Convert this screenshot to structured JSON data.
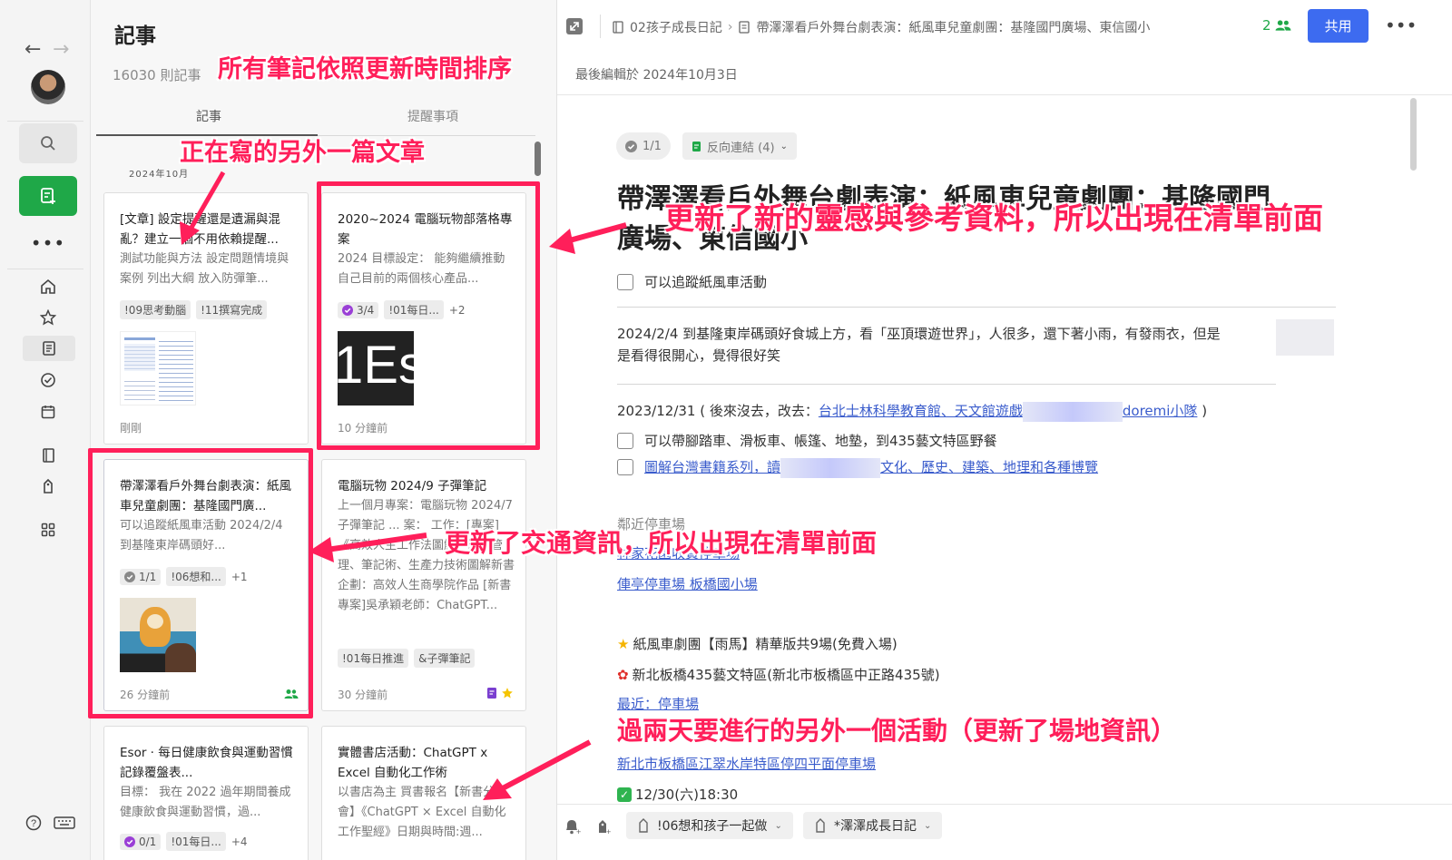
{
  "rail": {
    "back_icon": "arrow-left-icon",
    "forward_icon": "arrow-right-icon",
    "new_note_color": "#1fa848"
  },
  "list": {
    "title": "記事",
    "count": "16030 則記事",
    "tabs": [
      "記事",
      "提醒事項"
    ],
    "month": "2024年10月",
    "cards": [
      {
        "title": "[文章] 設定提醒還是遺漏與混亂？建立一個不用依賴提醒...",
        "snippet": "測試功能與方法 設定問題情境與案例 列出大綱 放入防彈筆...",
        "tags": [
          "!09思考動腦",
          "!11撰寫完成"
        ],
        "time": "剛剛"
      },
      {
        "title": "2020~2024 電腦玩物部落格專案",
        "snippet": "2024 目標設定： 能夠繼續推動自己目前的兩個核心產品...",
        "task": "3/4",
        "tags": [
          "!01每日..."
        ],
        "more": "+2",
        "thumb_text": "1Es",
        "time": "10 分鐘前"
      },
      {
        "title": "帶澤澤看戶外舞台劇表演：紙風車兒童劇團：基隆國門廣...",
        "snippet": "可以追蹤紙風車活動 2024/2/4 到基隆東岸碼頭好...",
        "task": "1/1",
        "tags": [
          "!06想和..."
        ],
        "more": "+1",
        "time": "26 分鐘前"
      },
      {
        "title": "電腦玩物 2024/9 子彈筆記",
        "snippet": "上一個月專案：電腦玩物 2024/7 子彈筆記 ... 案： 工作：[專案]《高效人生工作法圖解》時間管理、筆記術、生產力技術圖解新書企劃：高效人生商學院作品 [新書專案]吳承穎老師：ChatGPT...",
        "tags": [
          "!01每日推進",
          "&子彈筆記"
        ],
        "time": "30 分鐘前"
      },
      {
        "title": "Esor ‧ 每日健康飲食與運動習慣記錄覆盤表...",
        "snippet": "目標： 我在 2022 過年期間養成健康飲食與運動習慣，過...",
        "task": "0/1",
        "tags": [
          "!01每日..."
        ],
        "more": "+4"
      },
      {
        "title": "實體書店活動：ChatGPT x Excel 自動化工作術",
        "snippet": "以書店為主 買書報名【新書分享會】《ChatGPT × Excel 自動化工作聖經》日期與時間:週..."
      }
    ]
  },
  "editor": {
    "breadcrumb_notebook": "02孩子成長日記",
    "breadcrumb_note": "帶澤澤看戶外舞台劇表演：紙風車兒童劇團：基隆國門廣場、東信國小",
    "share_count": "2",
    "share_label": "共用",
    "last_edited": "最後編輯於 2024年10月3日",
    "task_chip": "1/1",
    "backlinks_chip": "反向連結 (4)",
    "title_line1": "帶澤澤看戶外舞台劇表演：紙風車兒童劇團：基隆國門",
    "title_line2": "廣場、東信國小",
    "check1": "可以追蹤紙風車活動",
    "para1_line1": "2024/2/4 到基隆東岸碼頭好食城上方，看「巫頂環遊世界」，人很多，還下著小雨，有發雨衣，但是",
    "para1_line2": "是看得很開心，覺得很好笑",
    "para2_prefix": "2023/12/31 ( 後來沒去，改去：",
    "para2_link": "台北士林科學教育館、天文館遊戲",
    "para2_link_tail": "doremi小隊",
    "para2_suffix": " )",
    "check2": "可以帶腳踏車、滑板車、帳篷、地墊，到435藝文特區野餐",
    "check3_link": "圖解台灣書籍系列，讀",
    "check3_link_tail": "文化、歷史、建築、地理和各種博覽",
    "parking_heading": "鄰近停車場",
    "parking_link1": "林家花園收費停車場",
    "parking_link2": "俥亭停車場 板橋國小場",
    "event_line": "紙風車劇團【雨馬】精華版共9場(免費入場)",
    "venue_line": "新北板橋435藝文特區(新北市板橋區中正路435號)",
    "nearby_link": "最近：停車場",
    "parking_link3": "新北市板橋區江翠水岸特區停四平面停車場",
    "date_line": "12/30(六)18:30",
    "bottom_tags": [
      "!06想和孩子一起做",
      "*澤澤成長日記"
    ]
  },
  "annotations": {
    "color": "#ff1f5a",
    "sorted_by_update": "所有筆記依照更新時間排序",
    "writing_other": "正在寫的另外一篇文章",
    "updated_inspiration": "更新了新的靈感與參考資料，所以出現在清單前面",
    "updated_traffic": "更新了交通資訊，所以出現在清單前面",
    "other_event": "過兩天要進行的另外一個活動（更新了場地資訊）"
  }
}
